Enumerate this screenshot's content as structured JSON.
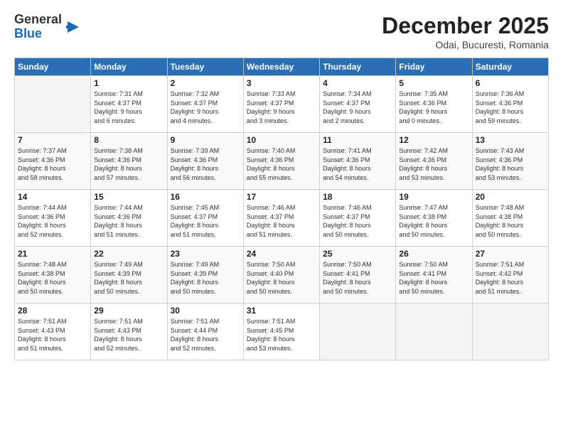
{
  "logo": {
    "general": "General",
    "blue": "Blue"
  },
  "title": "December 2025",
  "subtitle": "Odai, Bucuresti, Romania",
  "days_of_week": [
    "Sunday",
    "Monday",
    "Tuesday",
    "Wednesday",
    "Thursday",
    "Friday",
    "Saturday"
  ],
  "weeks": [
    [
      {
        "day": "",
        "info": ""
      },
      {
        "day": "1",
        "info": "Sunrise: 7:31 AM\nSunset: 4:37 PM\nDaylight: 9 hours\nand 6 minutes."
      },
      {
        "day": "2",
        "info": "Sunrise: 7:32 AM\nSunset: 4:37 PM\nDaylight: 9 hours\nand 4 minutes."
      },
      {
        "day": "3",
        "info": "Sunrise: 7:33 AM\nSunset: 4:37 PM\nDaylight: 9 hours\nand 3 minutes."
      },
      {
        "day": "4",
        "info": "Sunrise: 7:34 AM\nSunset: 4:37 PM\nDaylight: 9 hours\nand 2 minutes."
      },
      {
        "day": "5",
        "info": "Sunrise: 7:35 AM\nSunset: 4:36 PM\nDaylight: 9 hours\nand 0 minutes."
      },
      {
        "day": "6",
        "info": "Sunrise: 7:36 AM\nSunset: 4:36 PM\nDaylight: 8 hours\nand 59 minutes."
      }
    ],
    [
      {
        "day": "7",
        "info": "Sunrise: 7:37 AM\nSunset: 4:36 PM\nDaylight: 8 hours\nand 58 minutes."
      },
      {
        "day": "8",
        "info": "Sunrise: 7:38 AM\nSunset: 4:36 PM\nDaylight: 8 hours\nand 57 minutes."
      },
      {
        "day": "9",
        "info": "Sunrise: 7:39 AM\nSunset: 4:36 PM\nDaylight: 8 hours\nand 56 minutes."
      },
      {
        "day": "10",
        "info": "Sunrise: 7:40 AM\nSunset: 4:36 PM\nDaylight: 8 hours\nand 55 minutes."
      },
      {
        "day": "11",
        "info": "Sunrise: 7:41 AM\nSunset: 4:36 PM\nDaylight: 8 hours\nand 54 minutes."
      },
      {
        "day": "12",
        "info": "Sunrise: 7:42 AM\nSunset: 4:36 PM\nDaylight: 8 hours\nand 53 minutes."
      },
      {
        "day": "13",
        "info": "Sunrise: 7:43 AM\nSunset: 4:36 PM\nDaylight: 8 hours\nand 53 minutes."
      }
    ],
    [
      {
        "day": "14",
        "info": "Sunrise: 7:44 AM\nSunset: 4:36 PM\nDaylight: 8 hours\nand 52 minutes."
      },
      {
        "day": "15",
        "info": "Sunrise: 7:44 AM\nSunset: 4:36 PM\nDaylight: 8 hours\nand 51 minutes."
      },
      {
        "day": "16",
        "info": "Sunrise: 7:45 AM\nSunset: 4:37 PM\nDaylight: 8 hours\nand 51 minutes."
      },
      {
        "day": "17",
        "info": "Sunrise: 7:46 AM\nSunset: 4:37 PM\nDaylight: 8 hours\nand 51 minutes."
      },
      {
        "day": "18",
        "info": "Sunrise: 7:46 AM\nSunset: 4:37 PM\nDaylight: 8 hours\nand 50 minutes."
      },
      {
        "day": "19",
        "info": "Sunrise: 7:47 AM\nSunset: 4:38 PM\nDaylight: 8 hours\nand 50 minutes."
      },
      {
        "day": "20",
        "info": "Sunrise: 7:48 AM\nSunset: 4:38 PM\nDaylight: 8 hours\nand 50 minutes."
      }
    ],
    [
      {
        "day": "21",
        "info": "Sunrise: 7:48 AM\nSunset: 4:38 PM\nDaylight: 8 hours\nand 50 minutes."
      },
      {
        "day": "22",
        "info": "Sunrise: 7:49 AM\nSunset: 4:39 PM\nDaylight: 8 hours\nand 50 minutes."
      },
      {
        "day": "23",
        "info": "Sunrise: 7:49 AM\nSunset: 4:39 PM\nDaylight: 8 hours\nand 50 minutes."
      },
      {
        "day": "24",
        "info": "Sunrise: 7:50 AM\nSunset: 4:40 PM\nDaylight: 8 hours\nand 50 minutes."
      },
      {
        "day": "25",
        "info": "Sunrise: 7:50 AM\nSunset: 4:41 PM\nDaylight: 8 hours\nand 50 minutes."
      },
      {
        "day": "26",
        "info": "Sunrise: 7:50 AM\nSunset: 4:41 PM\nDaylight: 8 hours\nand 50 minutes."
      },
      {
        "day": "27",
        "info": "Sunrise: 7:51 AM\nSunset: 4:42 PM\nDaylight: 8 hours\nand 51 minutes."
      }
    ],
    [
      {
        "day": "28",
        "info": "Sunrise: 7:51 AM\nSunset: 4:43 PM\nDaylight: 8 hours\nand 51 minutes."
      },
      {
        "day": "29",
        "info": "Sunrise: 7:51 AM\nSunset: 4:43 PM\nDaylight: 8 hours\nand 52 minutes."
      },
      {
        "day": "30",
        "info": "Sunrise: 7:51 AM\nSunset: 4:44 PM\nDaylight: 8 hours\nand 52 minutes."
      },
      {
        "day": "31",
        "info": "Sunrise: 7:51 AM\nSunset: 4:45 PM\nDaylight: 8 hours\nand 53 minutes."
      },
      {
        "day": "",
        "info": ""
      },
      {
        "day": "",
        "info": ""
      },
      {
        "day": "",
        "info": ""
      }
    ]
  ]
}
